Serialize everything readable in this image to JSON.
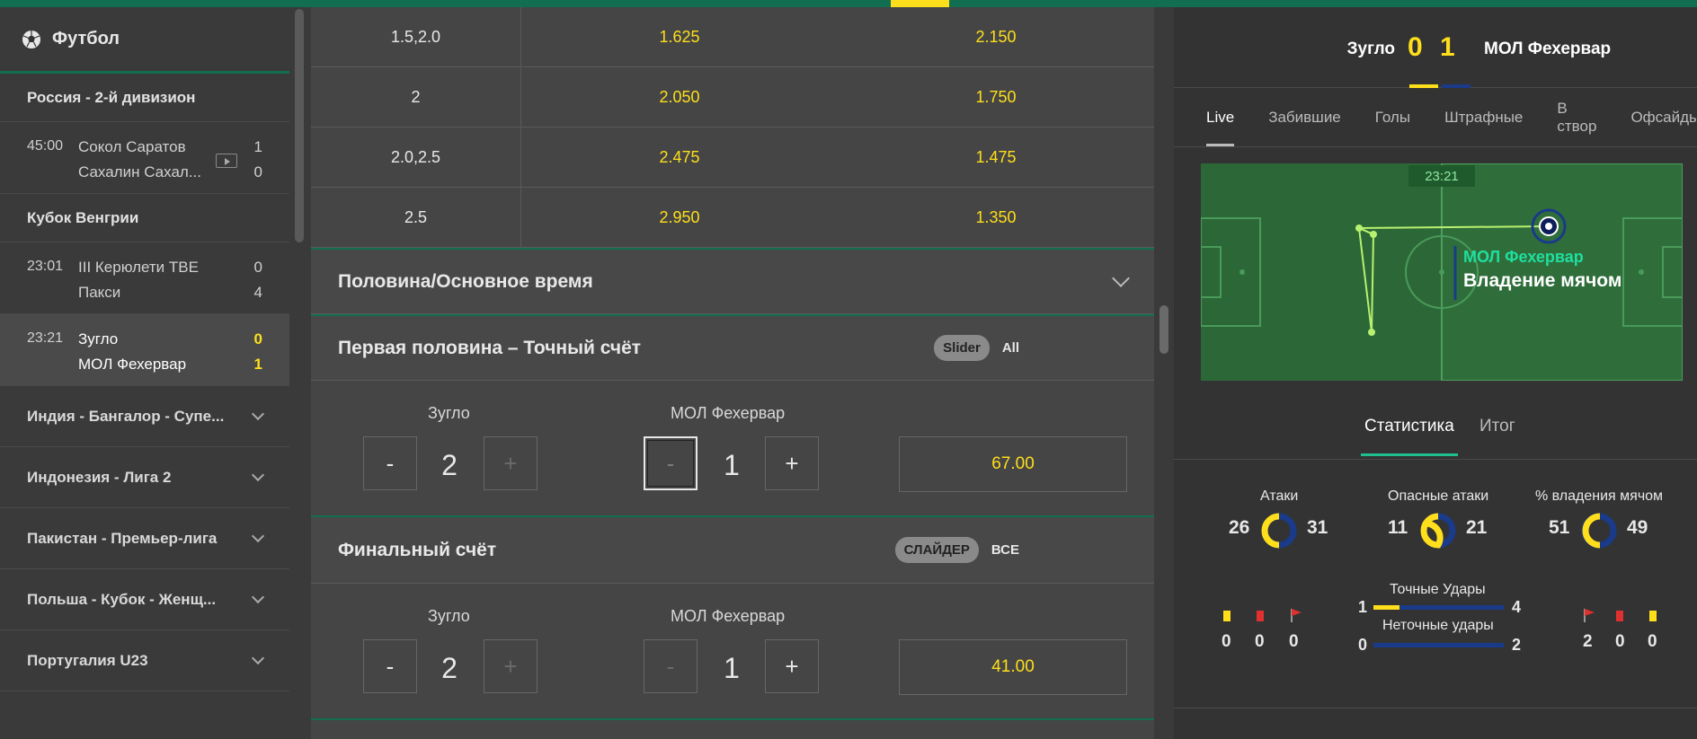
{
  "colors": {
    "accent": "#126e51",
    "odds": "#ffdf1b",
    "away": "#1a3a8a",
    "possession_label": "#1fdf9f"
  },
  "sidebar": {
    "title": "Футбол",
    "title_icon": "soccer-ball-icon",
    "leagues": [
      {
        "name": "Россия - 2-й дивизион"
      },
      {
        "name": "Кубок Венгрии"
      }
    ],
    "matches": [
      {
        "time": "45:00",
        "home": "Сокол Саратов",
        "away": "Сахалин Сахал...",
        "home_score": "1",
        "away_score": "0"
      },
      {
        "time": "23:01",
        "home": "III Керюлети ТВЕ",
        "away": "Пакси",
        "home_score": "0",
        "away_score": "4"
      },
      {
        "time": "23:21",
        "home": "Зугло",
        "away": "МОЛ Фехервар",
        "home_score": "0",
        "away_score": "1"
      }
    ],
    "collapsed": [
      "Индия - Бангалор - Супе...",
      "Индонезия - Лига 2",
      "Пакистан - Премьер-лига",
      "Польша - Кубок - Женщ...",
      "Португалия U23"
    ]
  },
  "center": {
    "odds_rows": [
      {
        "line": "1.5,2.0",
        "over": "1.625",
        "under": "2.150"
      },
      {
        "line": "2",
        "over": "2.050",
        "under": "1.750"
      },
      {
        "line": "2.0,2.5",
        "over": "2.475",
        "under": "1.475"
      },
      {
        "line": "2.5",
        "over": "2.950",
        "under": "1.350"
      }
    ],
    "half_time_section": "Половина/Основное время",
    "first_half": {
      "title": "Первая половина – Точный счёт",
      "toggle_on": "Slider",
      "toggle_off": "All",
      "home_label": "Зугло",
      "away_label": "МОЛ Фехервар",
      "home_value": "2",
      "away_value": "1",
      "minus": "-",
      "plus": "+",
      "odds": "67.00"
    },
    "final": {
      "title": "Финальный счёт",
      "toggle_on": "СЛАЙДЕР",
      "toggle_off": "ВСЕ",
      "home_label": "Зугло",
      "away_label": "МОЛ Фехервар",
      "home_value": "2",
      "away_value": "1",
      "minus": "-",
      "plus": "+",
      "odds": "41.00"
    }
  },
  "right": {
    "home": "Зугло",
    "away": "МОЛ Фехервар",
    "home_score": "0",
    "away_score": "1",
    "tabs": [
      "Live",
      "Забившие",
      "Голы",
      "Штрафные",
      "В створ",
      "Офсайды"
    ],
    "pitch": {
      "clock": "23:21",
      "team": "МОЛ Фехервар",
      "event": "Владение мячом"
    },
    "stat_tabs": [
      "Статистика",
      "Итог"
    ],
    "stats": {
      "attacks": {
        "label": "Атаки",
        "home": "26",
        "away": "31"
      },
      "dangerous": {
        "label": "Опасные атаки",
        "home": "11",
        "away": "21"
      },
      "possession": {
        "label": "% владения мячом",
        "home": "51",
        "away": "49"
      },
      "on_target": {
        "label": "Точные Удары",
        "home": "1",
        "away": "4"
      },
      "off_target": {
        "label": "Неточные удары",
        "home": "0",
        "away": "2"
      },
      "home_cards": {
        "yellow": "0",
        "red": "0",
        "corners": "0"
      },
      "away_cards": {
        "corners": "2",
        "red": "0",
        "yellow": "0"
      }
    }
  }
}
